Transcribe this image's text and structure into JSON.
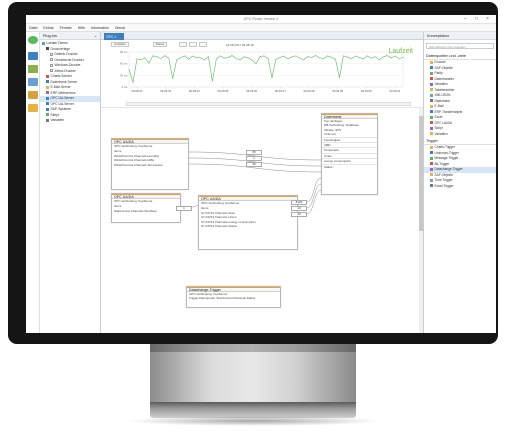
{
  "window": {
    "title": "OPC Router Version 4"
  },
  "menu": [
    "Datei",
    "Extras",
    "Fenster",
    "Hilfe",
    "Information",
    "Dienst"
  ],
  "plugins": {
    "title": "Plug-Ins",
    "items": [
      {
        "label": "Lokaler Dienst",
        "indent": 0,
        "color": "#5b9bd5"
      },
      {
        "label": "Druckverlage",
        "indent": 1,
        "color": "#4a4a4a"
      },
      {
        "label": "Datenb-Drucker",
        "indent": 2,
        "color": "#ffffff"
      },
      {
        "label": "Generische Drucker",
        "indent": 2,
        "color": "#ffffff"
      },
      {
        "label": "Windows-Drucker",
        "indent": 2,
        "color": "#ffffff"
      },
      {
        "label": "Zebra-Drucker",
        "indent": 2,
        "color": "#ffffff"
      },
      {
        "label": "Charts-Sender",
        "indent": 1,
        "color": "#d9534f"
      },
      {
        "label": "Datenbank-Server",
        "indent": 1,
        "color": "#3d7fbf"
      },
      {
        "label": "E-Mail-Server",
        "indent": 1,
        "color": "#f0ad4e"
      },
      {
        "label": "ERP-Webservice",
        "indent": 1,
        "color": "#8e6bbf"
      },
      {
        "label": "OPC DA-Server",
        "indent": 1,
        "color": "#3d7fbf",
        "selected": true
      },
      {
        "label": "OPC UA-Server",
        "indent": 1,
        "color": "#3d7fbf"
      },
      {
        "label": "SAP-Systeme",
        "indent": 1,
        "color": "#3d7fbf"
      },
      {
        "label": "Skript",
        "indent": 1,
        "color": "#5cb85c"
      },
      {
        "label": "Variablen",
        "indent": 1,
        "color": "#777777"
      }
    ]
  },
  "tab": {
    "label": "OPC"
  },
  "toolbar": {
    "buttons": [
      "Anhalten",
      "Pause",
      "",
      "",
      ""
    ],
    "timestamp": "01.08.2017 09:28:49"
  },
  "status": {
    "laufzeit": "Laufzeit"
  },
  "chart_data": {
    "type": "line",
    "title": "",
    "ylabel": "",
    "yticks": [
      "90 ms",
      "60 ms",
      "30 ms",
      "0 ms"
    ],
    "ylim": [
      0,
      90
    ],
    "x": [
      "09:28:22",
      "09:28:33",
      "09:28:44",
      "09:28:55",
      "09:29:06",
      "09:29:17",
      "09:29:28",
      "09:29:39",
      "09:29:50",
      "09:30:01"
    ],
    "values": [
      45,
      12,
      72,
      70,
      75,
      62,
      80,
      78,
      73,
      81,
      74,
      22,
      70,
      75,
      80,
      72,
      79,
      76,
      75,
      70,
      78,
      15,
      72,
      80,
      74,
      76,
      81,
      73,
      70,
      78,
      75,
      69,
      60,
      78,
      80,
      74,
      24,
      71,
      76,
      79,
      73,
      77,
      80,
      74,
      70,
      78,
      76,
      81,
      75,
      73,
      80,
      76,
      71,
      24,
      80,
      77,
      73,
      79,
      76,
      72,
      80,
      74,
      78,
      70,
      77,
      81,
      75,
      79,
      73,
      76
    ]
  },
  "canvas": {
    "nodes": [
      {
        "id": "n1",
        "title": "OPC UA/DA",
        "sub": "OPC-Verbindung: KepServer",
        "section": "Items",
        "rows": [
          "WAGOControl.Channels.Humidity",
          "WAGOControl.Channels.IdiBo",
          "WAGOControl.Channels.Temperatur"
        ],
        "values": [
          "65",
          "1",
          "49"
        ]
      },
      {
        "id": "n2",
        "title": "OPC UA/DA",
        "sub": "OPC-Verbindung: KepServer",
        "section": "Items",
        "rows": [
          "StartControl.Channels.StartStop"
        ],
        "values": [
          "1"
        ]
      },
      {
        "id": "n3",
        "title": "OPC UA/DA",
        "sub": "OPC-Verbindung: KepServer",
        "section": "Items",
        "rows": [
          "S7-04743.Channels.Start",
          "S7-04743.Channels.Unten",
          "S7-04743.Channels.energy-consumption",
          "S7-04743.Channels.Status"
        ],
        "values": [
          "8126",
          "13",
          "20"
        ]
      },
      {
        "id": "n4",
        "title": "Datenbank",
        "rows": [
          "Typ: Einfügen",
          "DB-Verbindung: Database",
          "Tabelle: SPS",
          "Columns",
          "Feuchtigkeit",
          "IdiBo",
          "Temperatur",
          "Unten",
          "energy consumption",
          "Status"
        ]
      },
      {
        "id": "n5",
        "title": "Datachange-Trigger",
        "rows": [
          "OPC-Verbindung: KepServer",
          "Trigger-Datenpunkt: StartControl.Channels.Status"
        ]
      }
    ]
  },
  "right": {
    "title": "Konzeptobox",
    "search_placeholder": "Schnellsuche hier eingeben",
    "sections": [
      {
        "title": "Datenquellen und -ziele",
        "items": [
          "Drucker",
          "SAP-Objekte",
          "Parity",
          "Datentransfer",
          "Variablen",
          "Tabellenreiher",
          "XML/JSON",
          "Datenbank",
          "E-Mail",
          "ERP-Transferobjekt",
          "Excel",
          "OPC UA/DA",
          "Skript",
          "Variablen"
        ]
      },
      {
        "title": "Trigger",
        "items": [
          "Charts-Trigger",
          "Unknown-Trigger",
          "Message-Trigger",
          "Bit-Trigger",
          "Datachange-Trigger",
          "SAP-Objekte",
          "Time-Trigger",
          "Email-Trigger"
        ]
      }
    ]
  },
  "colors": {
    "accent": "#3d7fbf",
    "chartline": "#5cb85c",
    "laufzeit": "#6fbf3c",
    "nodeborder": "#f0a030"
  }
}
